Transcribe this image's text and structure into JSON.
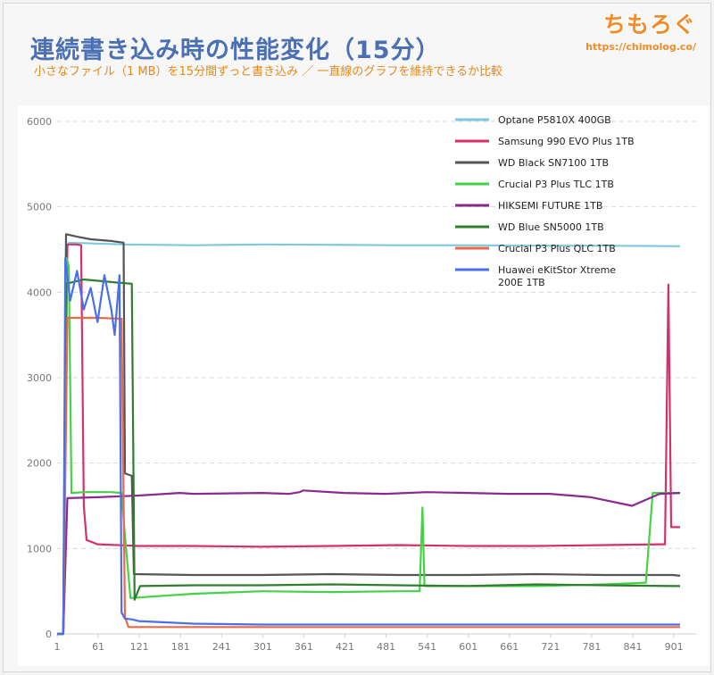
{
  "header": {
    "title": "連続書き込み時の性能変化（15分）",
    "subtitle": "小さなファイル（1 MB）を15分間ずっと書き込み ／ 一直線のグラフを維持できるか比較"
  },
  "logo": {
    "mark": "ちもろぐ",
    "url": "https://chimolog.co/"
  },
  "chart_data": {
    "type": "line",
    "title": "",
    "xlabel": "",
    "ylabel": "",
    "xlim": [
      1,
      910
    ],
    "ylim": [
      0,
      6000
    ],
    "x_ticks": [
      "1",
      "61",
      "121",
      "181",
      "241",
      "301",
      "361",
      "421",
      "481",
      "541",
      "601",
      "661",
      "721",
      "781",
      "841",
      "901"
    ],
    "y_ticks": [
      "0",
      "1000",
      "2000",
      "3000",
      "4000",
      "5000",
      "6000"
    ],
    "grid": "horizontal dashed",
    "legend_position": "top-right",
    "series": [
      {
        "name": "Optane P5810X 400GB",
        "color": "#7ec8e0",
        "points": [
          [
            1,
            0
          ],
          [
            10,
            0
          ],
          [
            14,
            4500
          ],
          [
            18,
            4580
          ],
          [
            100,
            4560
          ],
          [
            200,
            4550
          ],
          [
            300,
            4560
          ],
          [
            400,
            4555
          ],
          [
            500,
            4550
          ],
          [
            600,
            4550
          ],
          [
            700,
            4545
          ],
          [
            800,
            4545
          ],
          [
            900,
            4540
          ],
          [
            910,
            4540
          ]
        ]
      },
      {
        "name": "Samsung 990 EVO Plus 1TB",
        "color": "#d62f6c",
        "points": [
          [
            1,
            0
          ],
          [
            10,
            0
          ],
          [
            16,
            4560
          ],
          [
            30,
            4560
          ],
          [
            36,
            4550
          ],
          [
            40,
            1500
          ],
          [
            44,
            1100
          ],
          [
            60,
            1050
          ],
          [
            120,
            1030
          ],
          [
            200,
            1030
          ],
          [
            300,
            1020
          ],
          [
            400,
            1030
          ],
          [
            500,
            1040
          ],
          [
            600,
            1030
          ],
          [
            700,
            1030
          ],
          [
            800,
            1040
          ],
          [
            880,
            1050
          ],
          [
            888,
            1050
          ],
          [
            893,
            4090
          ],
          [
            897,
            1250
          ],
          [
            910,
            1250
          ]
        ]
      },
      {
        "name": "WD Black SN7100 1TB",
        "color": "#555555",
        "points": [
          [
            1,
            0
          ],
          [
            10,
            0
          ],
          [
            14,
            4680
          ],
          [
            30,
            4650
          ],
          [
            50,
            4620
          ],
          [
            80,
            4600
          ],
          [
            98,
            4580
          ],
          [
            100,
            1880
          ],
          [
            110,
            1850
          ],
          [
            113,
            700
          ],
          [
            200,
            690
          ],
          [
            300,
            690
          ],
          [
            400,
            700
          ],
          [
            500,
            690
          ],
          [
            600,
            690
          ],
          [
            700,
            700
          ],
          [
            800,
            690
          ],
          [
            900,
            690
          ],
          [
            910,
            680
          ]
        ]
      },
      {
        "name": "Crucial P3 Plus TLC 1TB",
        "color": "#46d246",
        "points": [
          [
            1,
            0
          ],
          [
            10,
            0
          ],
          [
            15,
            4400
          ],
          [
            18,
            4300
          ],
          [
            22,
            1650
          ],
          [
            40,
            1660
          ],
          [
            60,
            1660
          ],
          [
            80,
            1660
          ],
          [
            95,
            1650
          ],
          [
            100,
            1150
          ],
          [
            108,
            420
          ],
          [
            200,
            470
          ],
          [
            300,
            500
          ],
          [
            400,
            490
          ],
          [
            500,
            500
          ],
          [
            530,
            500
          ],
          [
            534,
            1480
          ],
          [
            537,
            560
          ],
          [
            600,
            560
          ],
          [
            700,
            560
          ],
          [
            800,
            580
          ],
          [
            860,
            600
          ],
          [
            870,
            1650
          ],
          [
            910,
            1650
          ]
        ]
      },
      {
        "name": "HIKSEMI FUTURE 1TB",
        "color": "#8b2a8e",
        "points": [
          [
            1,
            0
          ],
          [
            10,
            0
          ],
          [
            16,
            1590
          ],
          [
            60,
            1600
          ],
          [
            120,
            1620
          ],
          [
            180,
            1650
          ],
          [
            200,
            1640
          ],
          [
            300,
            1650
          ],
          [
            340,
            1640
          ],
          [
            355,
            1660
          ],
          [
            360,
            1680
          ],
          [
            420,
            1650
          ],
          [
            480,
            1640
          ],
          [
            540,
            1660
          ],
          [
            600,
            1650
          ],
          [
            660,
            1640
          ],
          [
            720,
            1640
          ],
          [
            780,
            1600
          ],
          [
            840,
            1500
          ],
          [
            880,
            1640
          ],
          [
            910,
            1650
          ]
        ]
      },
      {
        "name": "WD Blue SN5000 1TB",
        "color": "#2f7d2f",
        "points": [
          [
            1,
            0
          ],
          [
            10,
            0
          ],
          [
            14,
            4100
          ],
          [
            40,
            4150
          ],
          [
            80,
            4120
          ],
          [
            110,
            4100
          ],
          [
            114,
            400
          ],
          [
            122,
            560
          ],
          [
            200,
            570
          ],
          [
            300,
            570
          ],
          [
            400,
            580
          ],
          [
            500,
            570
          ],
          [
            600,
            560
          ],
          [
            700,
            580
          ],
          [
            800,
            570
          ],
          [
            900,
            560
          ],
          [
            910,
            560
          ]
        ]
      },
      {
        "name": "Crucial P3 Plus QLC 1TB",
        "color": "#e8684a",
        "points": [
          [
            1,
            0
          ],
          [
            10,
            0
          ],
          [
            16,
            3700
          ],
          [
            60,
            3700
          ],
          [
            95,
            3690
          ],
          [
            100,
            200
          ],
          [
            105,
            80
          ],
          [
            200,
            80
          ],
          [
            300,
            80
          ],
          [
            400,
            80
          ],
          [
            500,
            80
          ],
          [
            600,
            80
          ],
          [
            700,
            80
          ],
          [
            800,
            80
          ],
          [
            900,
            80
          ],
          [
            910,
            80
          ]
        ]
      },
      {
        "name": "Huawei eKitStor Xtreme 200E 1TB",
        "color": "#4a6fe8",
        "points": [
          [
            1,
            0
          ],
          [
            10,
            0
          ],
          [
            13,
            4400
          ],
          [
            20,
            3900
          ],
          [
            30,
            4250
          ],
          [
            40,
            3800
          ],
          [
            50,
            4050
          ],
          [
            60,
            3650
          ],
          [
            70,
            4200
          ],
          [
            80,
            3800
          ],
          [
            85,
            3500
          ],
          [
            92,
            4200
          ],
          [
            95,
            250
          ],
          [
            100,
            180
          ],
          [
            110,
            170
          ],
          [
            120,
            150
          ],
          [
            200,
            120
          ],
          [
            300,
            110
          ],
          [
            400,
            110
          ],
          [
            500,
            110
          ],
          [
            600,
            110
          ],
          [
            700,
            110
          ],
          [
            800,
            110
          ],
          [
            900,
            110
          ],
          [
            910,
            110
          ]
        ]
      }
    ]
  },
  "legend_lines": [
    [
      "Optane P5810X 400GB"
    ],
    [
      "Samsung 990 EVO Plus 1TB"
    ],
    [
      "WD Black SN7100 1TB"
    ],
    [
      "Crucial P3 Plus TLC 1TB"
    ],
    [
      "HIKSEMI FUTURE 1TB"
    ],
    [
      "WD Blue SN5000 1TB"
    ],
    [
      "Crucial P3 Plus QLC 1TB"
    ],
    [
      "Huawei eKitStor Xtreme",
      "200E 1TB"
    ]
  ]
}
